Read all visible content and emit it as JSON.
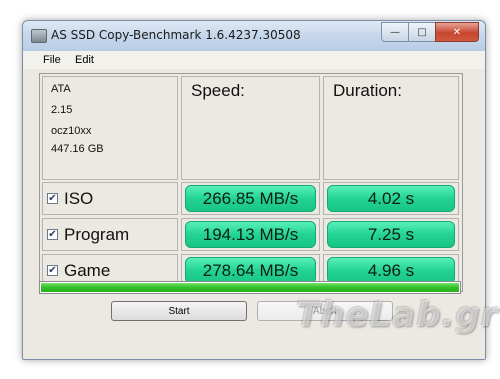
{
  "window": {
    "title": "AS SSD Copy-Benchmark 1.6.4237.30508"
  },
  "caption_buttons": {
    "minimize": "—",
    "maximize": "□",
    "close": "✕"
  },
  "menu": {
    "file": "File",
    "edit": "Edit"
  },
  "drive_info": {
    "type": "ATA",
    "version": "2.15",
    "name": "ocz10xx",
    "size": "447.16 GB"
  },
  "headers": {
    "speed": "Speed:",
    "duration": "Duration:"
  },
  "rows": [
    {
      "label": "ISO",
      "checked": true,
      "speed": "266.85 MB/s",
      "duration": "4.02 s"
    },
    {
      "label": "Program",
      "checked": true,
      "speed": "194.13 MB/s",
      "duration": "7.25 s"
    },
    {
      "label": "Game",
      "checked": true,
      "speed": "278.64 MB/s",
      "duration": "4.96 s"
    }
  ],
  "check_glyph": "✔",
  "progress": {
    "value": 1.0
  },
  "buttons": {
    "start": "Start",
    "abort": "Abort"
  },
  "watermark": "TheLab.gr",
  "colors": {
    "pill": "#22d394",
    "progress": "#2fbf25"
  }
}
